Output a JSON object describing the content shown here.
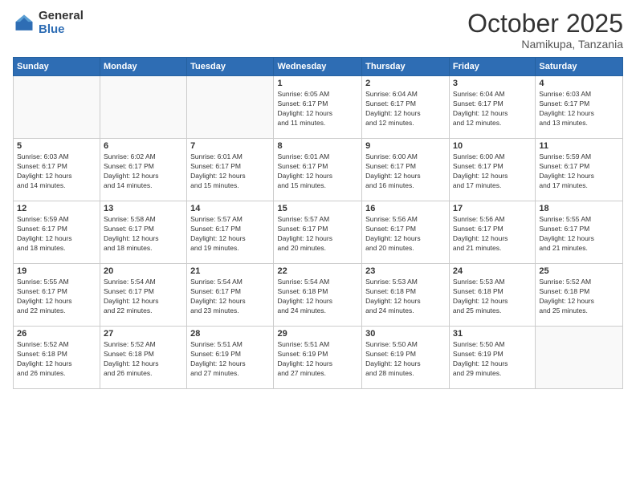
{
  "logo": {
    "general": "General",
    "blue": "Blue"
  },
  "header": {
    "month": "October 2025",
    "location": "Namikupa, Tanzania"
  },
  "weekdays": [
    "Sunday",
    "Monday",
    "Tuesday",
    "Wednesday",
    "Thursday",
    "Friday",
    "Saturday"
  ],
  "weeks": [
    [
      {
        "day": "",
        "info": ""
      },
      {
        "day": "",
        "info": ""
      },
      {
        "day": "",
        "info": ""
      },
      {
        "day": "1",
        "info": "Sunrise: 6:05 AM\nSunset: 6:17 PM\nDaylight: 12 hours\nand 11 minutes."
      },
      {
        "day": "2",
        "info": "Sunrise: 6:04 AM\nSunset: 6:17 PM\nDaylight: 12 hours\nand 12 minutes."
      },
      {
        "day": "3",
        "info": "Sunrise: 6:04 AM\nSunset: 6:17 PM\nDaylight: 12 hours\nand 12 minutes."
      },
      {
        "day": "4",
        "info": "Sunrise: 6:03 AM\nSunset: 6:17 PM\nDaylight: 12 hours\nand 13 minutes."
      }
    ],
    [
      {
        "day": "5",
        "info": "Sunrise: 6:03 AM\nSunset: 6:17 PM\nDaylight: 12 hours\nand 14 minutes."
      },
      {
        "day": "6",
        "info": "Sunrise: 6:02 AM\nSunset: 6:17 PM\nDaylight: 12 hours\nand 14 minutes."
      },
      {
        "day": "7",
        "info": "Sunrise: 6:01 AM\nSunset: 6:17 PM\nDaylight: 12 hours\nand 15 minutes."
      },
      {
        "day": "8",
        "info": "Sunrise: 6:01 AM\nSunset: 6:17 PM\nDaylight: 12 hours\nand 15 minutes."
      },
      {
        "day": "9",
        "info": "Sunrise: 6:00 AM\nSunset: 6:17 PM\nDaylight: 12 hours\nand 16 minutes."
      },
      {
        "day": "10",
        "info": "Sunrise: 6:00 AM\nSunset: 6:17 PM\nDaylight: 12 hours\nand 17 minutes."
      },
      {
        "day": "11",
        "info": "Sunrise: 5:59 AM\nSunset: 6:17 PM\nDaylight: 12 hours\nand 17 minutes."
      }
    ],
    [
      {
        "day": "12",
        "info": "Sunrise: 5:59 AM\nSunset: 6:17 PM\nDaylight: 12 hours\nand 18 minutes."
      },
      {
        "day": "13",
        "info": "Sunrise: 5:58 AM\nSunset: 6:17 PM\nDaylight: 12 hours\nand 18 minutes."
      },
      {
        "day": "14",
        "info": "Sunrise: 5:57 AM\nSunset: 6:17 PM\nDaylight: 12 hours\nand 19 minutes."
      },
      {
        "day": "15",
        "info": "Sunrise: 5:57 AM\nSunset: 6:17 PM\nDaylight: 12 hours\nand 20 minutes."
      },
      {
        "day": "16",
        "info": "Sunrise: 5:56 AM\nSunset: 6:17 PM\nDaylight: 12 hours\nand 20 minutes."
      },
      {
        "day": "17",
        "info": "Sunrise: 5:56 AM\nSunset: 6:17 PM\nDaylight: 12 hours\nand 21 minutes."
      },
      {
        "day": "18",
        "info": "Sunrise: 5:55 AM\nSunset: 6:17 PM\nDaylight: 12 hours\nand 21 minutes."
      }
    ],
    [
      {
        "day": "19",
        "info": "Sunrise: 5:55 AM\nSunset: 6:17 PM\nDaylight: 12 hours\nand 22 minutes."
      },
      {
        "day": "20",
        "info": "Sunrise: 5:54 AM\nSunset: 6:17 PM\nDaylight: 12 hours\nand 22 minutes."
      },
      {
        "day": "21",
        "info": "Sunrise: 5:54 AM\nSunset: 6:17 PM\nDaylight: 12 hours\nand 23 minutes."
      },
      {
        "day": "22",
        "info": "Sunrise: 5:54 AM\nSunset: 6:18 PM\nDaylight: 12 hours\nand 24 minutes."
      },
      {
        "day": "23",
        "info": "Sunrise: 5:53 AM\nSunset: 6:18 PM\nDaylight: 12 hours\nand 24 minutes."
      },
      {
        "day": "24",
        "info": "Sunrise: 5:53 AM\nSunset: 6:18 PM\nDaylight: 12 hours\nand 25 minutes."
      },
      {
        "day": "25",
        "info": "Sunrise: 5:52 AM\nSunset: 6:18 PM\nDaylight: 12 hours\nand 25 minutes."
      }
    ],
    [
      {
        "day": "26",
        "info": "Sunrise: 5:52 AM\nSunset: 6:18 PM\nDaylight: 12 hours\nand 26 minutes."
      },
      {
        "day": "27",
        "info": "Sunrise: 5:52 AM\nSunset: 6:18 PM\nDaylight: 12 hours\nand 26 minutes."
      },
      {
        "day": "28",
        "info": "Sunrise: 5:51 AM\nSunset: 6:19 PM\nDaylight: 12 hours\nand 27 minutes."
      },
      {
        "day": "29",
        "info": "Sunrise: 5:51 AM\nSunset: 6:19 PM\nDaylight: 12 hours\nand 27 minutes."
      },
      {
        "day": "30",
        "info": "Sunrise: 5:50 AM\nSunset: 6:19 PM\nDaylight: 12 hours\nand 28 minutes."
      },
      {
        "day": "31",
        "info": "Sunrise: 5:50 AM\nSunset: 6:19 PM\nDaylight: 12 hours\nand 29 minutes."
      },
      {
        "day": "",
        "info": ""
      }
    ]
  ]
}
